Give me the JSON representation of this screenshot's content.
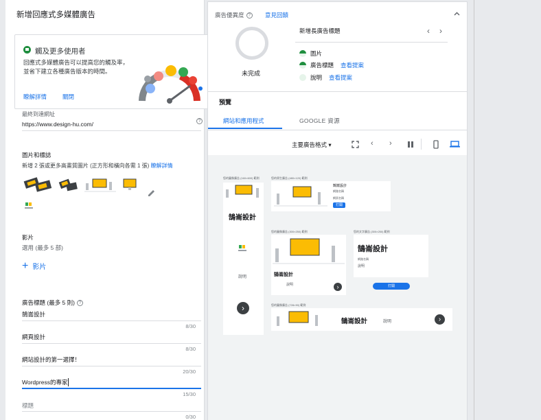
{
  "left_panel": {
    "title": "新增回應式多媒體廣告",
    "hint": {
      "title": "觸及更多使用者",
      "body": "回應式多媒體廣告可以提高您的觸及率，並省下建立各種廣告版本的時間。",
      "learn_more": "瞭解詳情",
      "close": "關閉"
    },
    "final_url": {
      "label": "最終到達網址",
      "value": "https://www.design-hu.com/"
    },
    "images": {
      "title": "圖片和標誌",
      "description": "新增 2 張或更多高畫質圖片 (正方形和橫向各需 1 張)",
      "learn_more": "瞭解詳情"
    },
    "video": {
      "title": "影片",
      "subtitle": "選用 (最多 5 部)",
      "add_label": "影片"
    },
    "headlines": {
      "title": "廣告標題 (最多 5 則)",
      "items": [
        {
          "value": "鵠崙設計",
          "counter": "8/30"
        },
        {
          "value": "網頁設計",
          "counter": "8/30"
        },
        {
          "value": "網站設計的第一選擇！",
          "counter": "20/30"
        },
        {
          "value": "Wordpress的專家",
          "counter": "15/30"
        },
        {
          "value": "",
          "placeholder": "標題",
          "counter": "0/30"
        }
      ]
    }
  },
  "ad_strength": {
    "label": "廣告優異度",
    "feedback": "意見回饋",
    "status": "未完成",
    "suggestion_title": "新增長廣告標題",
    "criteria": [
      {
        "name": "圖片",
        "link": ""
      },
      {
        "name": "廣告標題",
        "link": "查看提案"
      },
      {
        "name": "說明",
        "link": "查看提案"
      }
    ]
  },
  "preview": {
    "title": "預覽",
    "tabs": [
      "網站和應用程式",
      "GOOGLE 資源"
    ],
    "format": "主要廣告格式",
    "ads": {
      "cap_1": "您的圖像廣告 (160×600) 範例",
      "cap_2": "您的原生廣告 (480×120) 範例",
      "cap_3": "您的圖像廣告 (300×250) 範例",
      "cap_4": "您的文字廣告 (300×250) 範例",
      "cap_5": "您的圖像廣告 (728×90) 範例",
      "brand": "鵠崙設計",
      "desc": "說明",
      "open": "打開",
      "small_brand": "鵠崙設計",
      "small_sub": "網路名稱",
      "small_link": "網頁名稱"
    }
  },
  "colors": {
    "accent": "#1a73e8",
    "success": "#1e8e3e",
    "ring": "#dadce0"
  }
}
